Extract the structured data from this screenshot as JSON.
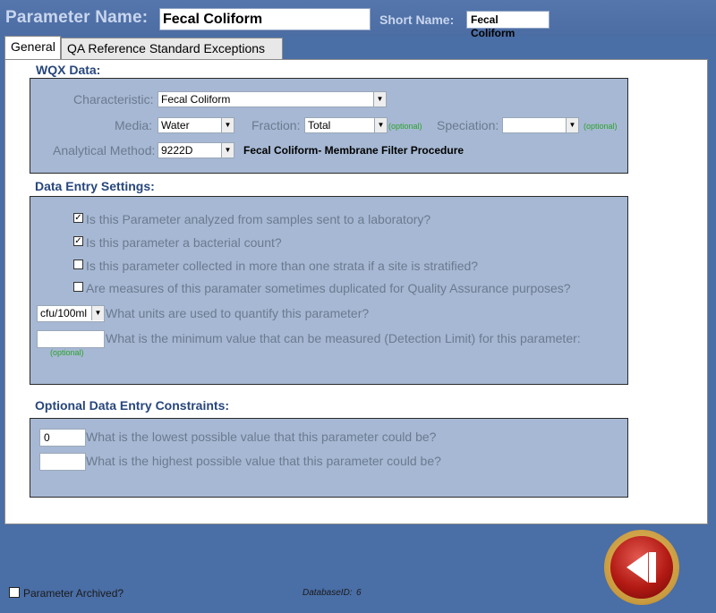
{
  "header": {
    "param_label": "Parameter Name:",
    "param_value": "Fecal Coliform",
    "short_label": "Short Name:",
    "short_value": "Fecal Coliform"
  },
  "tabs": [
    {
      "label": "General",
      "active": true
    },
    {
      "label": "QA Reference Standard Exceptions",
      "active": false
    }
  ],
  "wqx": {
    "title": "WQX Data:",
    "characteristic_label": "Characteristic:",
    "characteristic_value": "Fecal Coliform",
    "media_label": "Media:",
    "media_value": "Water",
    "fraction_label": "Fraction:",
    "fraction_value": "Total",
    "fraction_optional": "(optional)",
    "speciation_label": "Speciation:",
    "speciation_value": "",
    "speciation_optional": "(optional)",
    "method_label": "Analytical Method:",
    "method_value": "9222D",
    "method_description": "Fecal Coliform- Membrane Filter Procedure"
  },
  "data_entry": {
    "title": "Data Entry Settings:",
    "questions": [
      {
        "label": "Is this Parameter analyzed from samples sent to a laboratory?",
        "checked": true
      },
      {
        "label": "Is this parameter a bacterial count?",
        "checked": true
      },
      {
        "label": "Is this parameter collected in more than one strata if a site is stratified?",
        "checked": false
      },
      {
        "label": "Are measures of this paramater sometimes duplicated for Quality Assurance purposes?",
        "checked": false
      }
    ],
    "units_value": "cfu/100ml",
    "units_label": "What units are used to quantify this parameter?",
    "detection_value": "",
    "detection_label": "What is the minimum value that can be measured (Detection Limit) for this parameter:",
    "detection_optional": "(optional)"
  },
  "constraints": {
    "title": "Optional Data Entry Constraints:",
    "lowest_value": "0",
    "lowest_label": "What is the lowest possible value that this parameter could be?",
    "highest_value": "",
    "highest_label": "What is the highest possible value that this parameter could be?"
  },
  "footer": {
    "archived_label": "Parameter Archived?",
    "archived_checked": false,
    "dbid_label": "DatabaseID:",
    "dbid_value": "6"
  },
  "icons": {
    "dropdown": "chevron-down-icon",
    "checkmark": "check-icon",
    "back": "back-arrow-icon"
  },
  "colors": {
    "background": "#4a6ea6",
    "panel": "#ffffff",
    "section_box": "#a6b8d3",
    "section_title": "#27467c",
    "optional_text": "#2da32d",
    "back_button": "#b31a14"
  }
}
